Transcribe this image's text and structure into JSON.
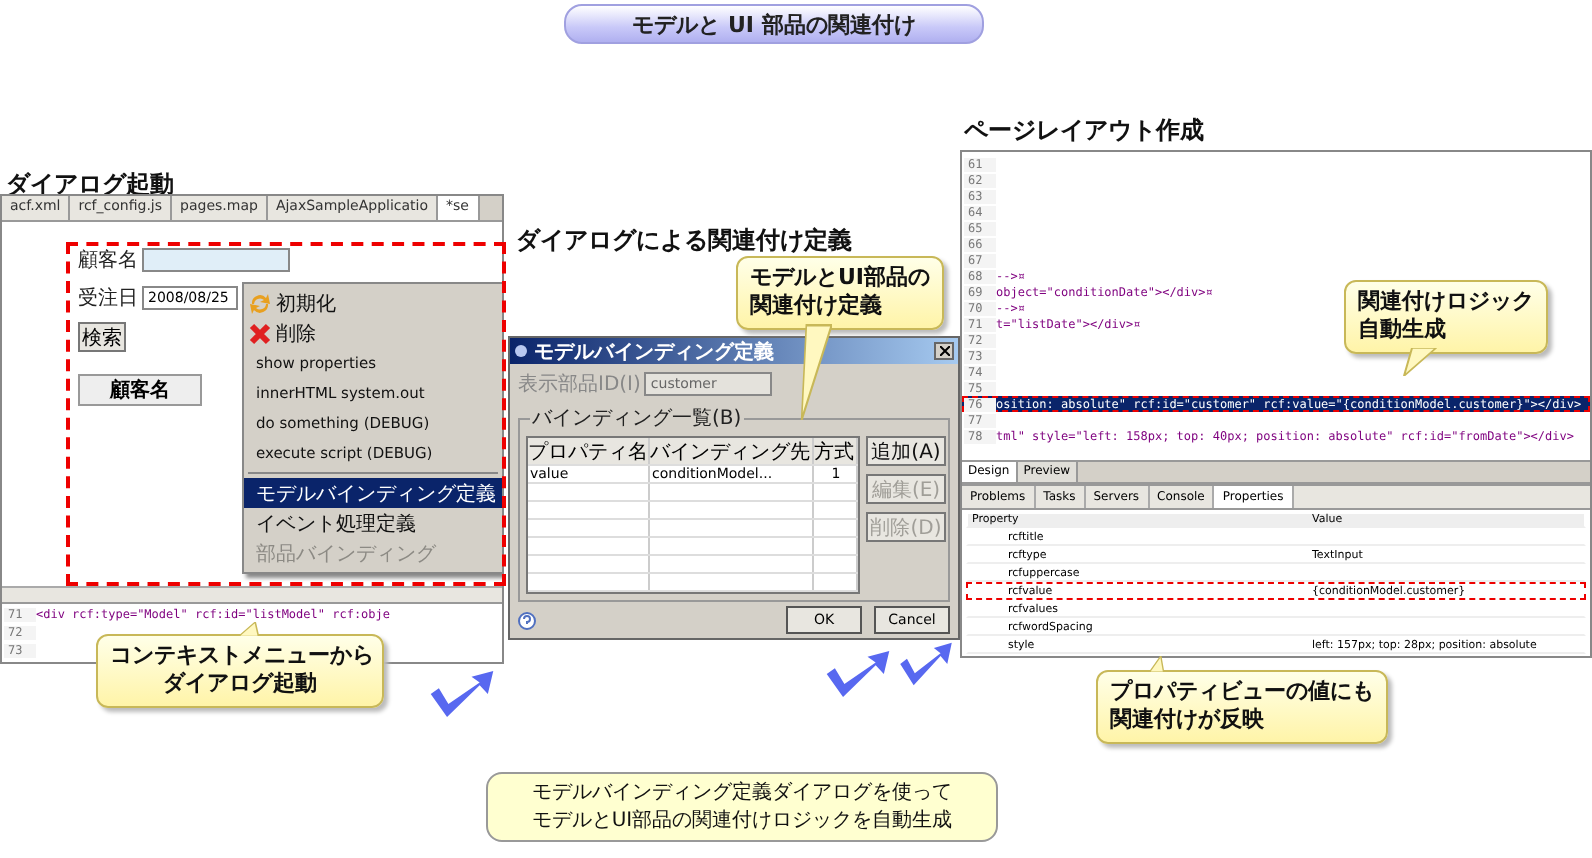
{
  "banner": {
    "title": "モデルと UI 部品の関連付け"
  },
  "dialog_launch": {
    "heading": "ダイアログ起動",
    "editor_tabs": [
      {
        "label": "acf.xml",
        "selected": false
      },
      {
        "label": "rcf_config.js",
        "selected": false
      },
      {
        "label": "pages.map",
        "selected": false
      },
      {
        "label": "AjaxSampleApplicatio",
        "selected": false
      },
      {
        "label": "*se",
        "selected": true
      }
    ],
    "form": {
      "customer_label": "顧客名",
      "order_date_label": "受注日",
      "order_date_value": "2008/08/25",
      "search_button": "検索",
      "table_header": "顧客名"
    },
    "context_menu": [
      {
        "label": "初期化",
        "kind": "icon",
        "selected": false,
        "disabled": false,
        "separator_before": false
      },
      {
        "label": "削除",
        "kind": "icon",
        "selected": false,
        "disabled": false,
        "separator_before": false
      },
      {
        "label": "show properties",
        "kind": "plain",
        "selected": false,
        "disabled": false,
        "separator_before": false
      },
      {
        "label": "innerHTML system.out",
        "kind": "plain",
        "selected": false,
        "disabled": false,
        "separator_before": false
      },
      {
        "label": "do something (DEBUG)",
        "kind": "plain",
        "selected": false,
        "disabled": false,
        "separator_before": false
      },
      {
        "label": "execute script (DEBUG)",
        "kind": "plain",
        "selected": false,
        "disabled": false,
        "separator_before": false
      },
      {
        "label": "モデルバインディング定義",
        "kind": "plain",
        "selected": true,
        "disabled": false,
        "separator_before": true
      },
      {
        "label": "イベント処理定義",
        "kind": "plain",
        "selected": false,
        "disabled": false,
        "separator_before": false
      },
      {
        "label": "部品バインディング",
        "kind": "plain",
        "selected": false,
        "disabled": true,
        "separator_before": false
      }
    ],
    "code_lines": [
      {
        "number": "71",
        "code": "<div rcf:type=\"Model\" rcf:id=\"listModel\" rcf:obje"
      },
      {
        "number": "72"
      },
      {
        "number": "73"
      }
    ],
    "callout": [
      "コンテキストメニューから",
      "ダイアログ起動"
    ]
  },
  "binding_dialog": {
    "heading": "ダイアログによる関連付け定義",
    "window_title": "モデルバインディング定義",
    "field_label": "表示部品ID(I)",
    "field_value": "customer",
    "group_label": "バインディング一覧(B)",
    "columns": [
      "プロパティ名",
      "バインディング先",
      "方式"
    ],
    "rows": [
      [
        "value",
        "conditionModel...",
        "1"
      ]
    ],
    "side_buttons": [
      {
        "label": "追加(A)",
        "disabled": false
      },
      {
        "label": "編集(E)",
        "disabled": true
      },
      {
        "label": "削除(D)",
        "disabled": true
      }
    ],
    "buttons": [
      "OK",
      "Cancel"
    ],
    "callout": [
      "モデルとUI部品の",
      "関連付け定義"
    ]
  },
  "page_layout": {
    "heading": "ページレイアウト作成",
    "code_lines": [
      {
        "number": "61",
        "selected": false,
        "highlighted": false
      },
      {
        "number": "62",
        "selected": false,
        "highlighted": false
      },
      {
        "number": "63",
        "selected": false,
        "highlighted": false
      },
      {
        "number": "64",
        "selected": false,
        "highlighted": false
      },
      {
        "number": "65",
        "selected": false,
        "highlighted": false
      },
      {
        "number": "66",
        "selected": false,
        "highlighted": false
      },
      {
        "number": "67",
        "selected": false,
        "highlighted": false
      },
      {
        "number": "68",
        "code": "-->¤",
        "selected": false,
        "highlighted": false
      },
      {
        "number": "69",
        "code": "object=\"conditionDate\"></div>¤",
        "selected": false,
        "highlighted": false
      },
      {
        "number": "70",
        "code": "-->¤",
        "selected": false,
        "highlighted": false
      },
      {
        "number": "71",
        "code": "t=\"listDate\"></div>¤",
        "selected": false,
        "highlighted": false
      },
      {
        "number": "72",
        "selected": false,
        "highlighted": false
      },
      {
        "number": "73",
        "selected": false,
        "highlighted": false
      },
      {
        "number": "74",
        "selected": false,
        "highlighted": false
      },
      {
        "number": "75",
        "selected": false,
        "highlighted": false
      },
      {
        "number": "76",
        "code": "osition: absolute\" rcf:id=\"customer\" rcf:value=\"{conditionModel.customer}\"></div>",
        "selected": true,
        "highlighted": true
      },
      {
        "number": "77",
        "selected": false,
        "highlighted": false
      },
      {
        "number": "78",
        "code": "tml\" style=\"left: 158px; top: 40px; position: absolute\" rcf:id=\"fromDate\"></div>",
        "selected": false,
        "highlighted": false
      }
    ],
    "view_tabs": [
      {
        "label": "Design",
        "selected": true
      },
      {
        "label": "Preview",
        "selected": false
      }
    ],
    "panel_tabs": [
      {
        "label": "Problems",
        "selected": false
      },
      {
        "label": "Tasks",
        "selected": false
      },
      {
        "label": "Servers",
        "selected": false
      },
      {
        "label": "Console",
        "selected": false
      },
      {
        "label": "Properties",
        "selected": true
      }
    ],
    "properties_columns": [
      "Property",
      "Value"
    ],
    "properties": [
      {
        "name": "rcftitle",
        "highlighted": false
      },
      {
        "name": "rcftype",
        "value": "TextInput",
        "highlighted": false
      },
      {
        "name": "rcfuppercase",
        "highlighted": false
      },
      {
        "name": "rcfvalue",
        "value": "{conditionModel.customer}",
        "highlighted": true
      },
      {
        "name": "rcfvalues",
        "highlighted": false
      },
      {
        "name": "rcfwordSpacing",
        "highlighted": false
      },
      {
        "name": "style",
        "value": "left: 157px; top: 28px; position: absolute",
        "highlighted": false
      }
    ],
    "code_callout": [
      "関連付けロジック",
      "自動生成"
    ],
    "properties_callout": [
      "プロパティビューの値にも",
      "関連付けが反映"
    ]
  },
  "summary": [
    "モデルバインディング定義ダイアログを使って",
    "モデルとUI部品の関連付けロジックを自動生成"
  ]
}
